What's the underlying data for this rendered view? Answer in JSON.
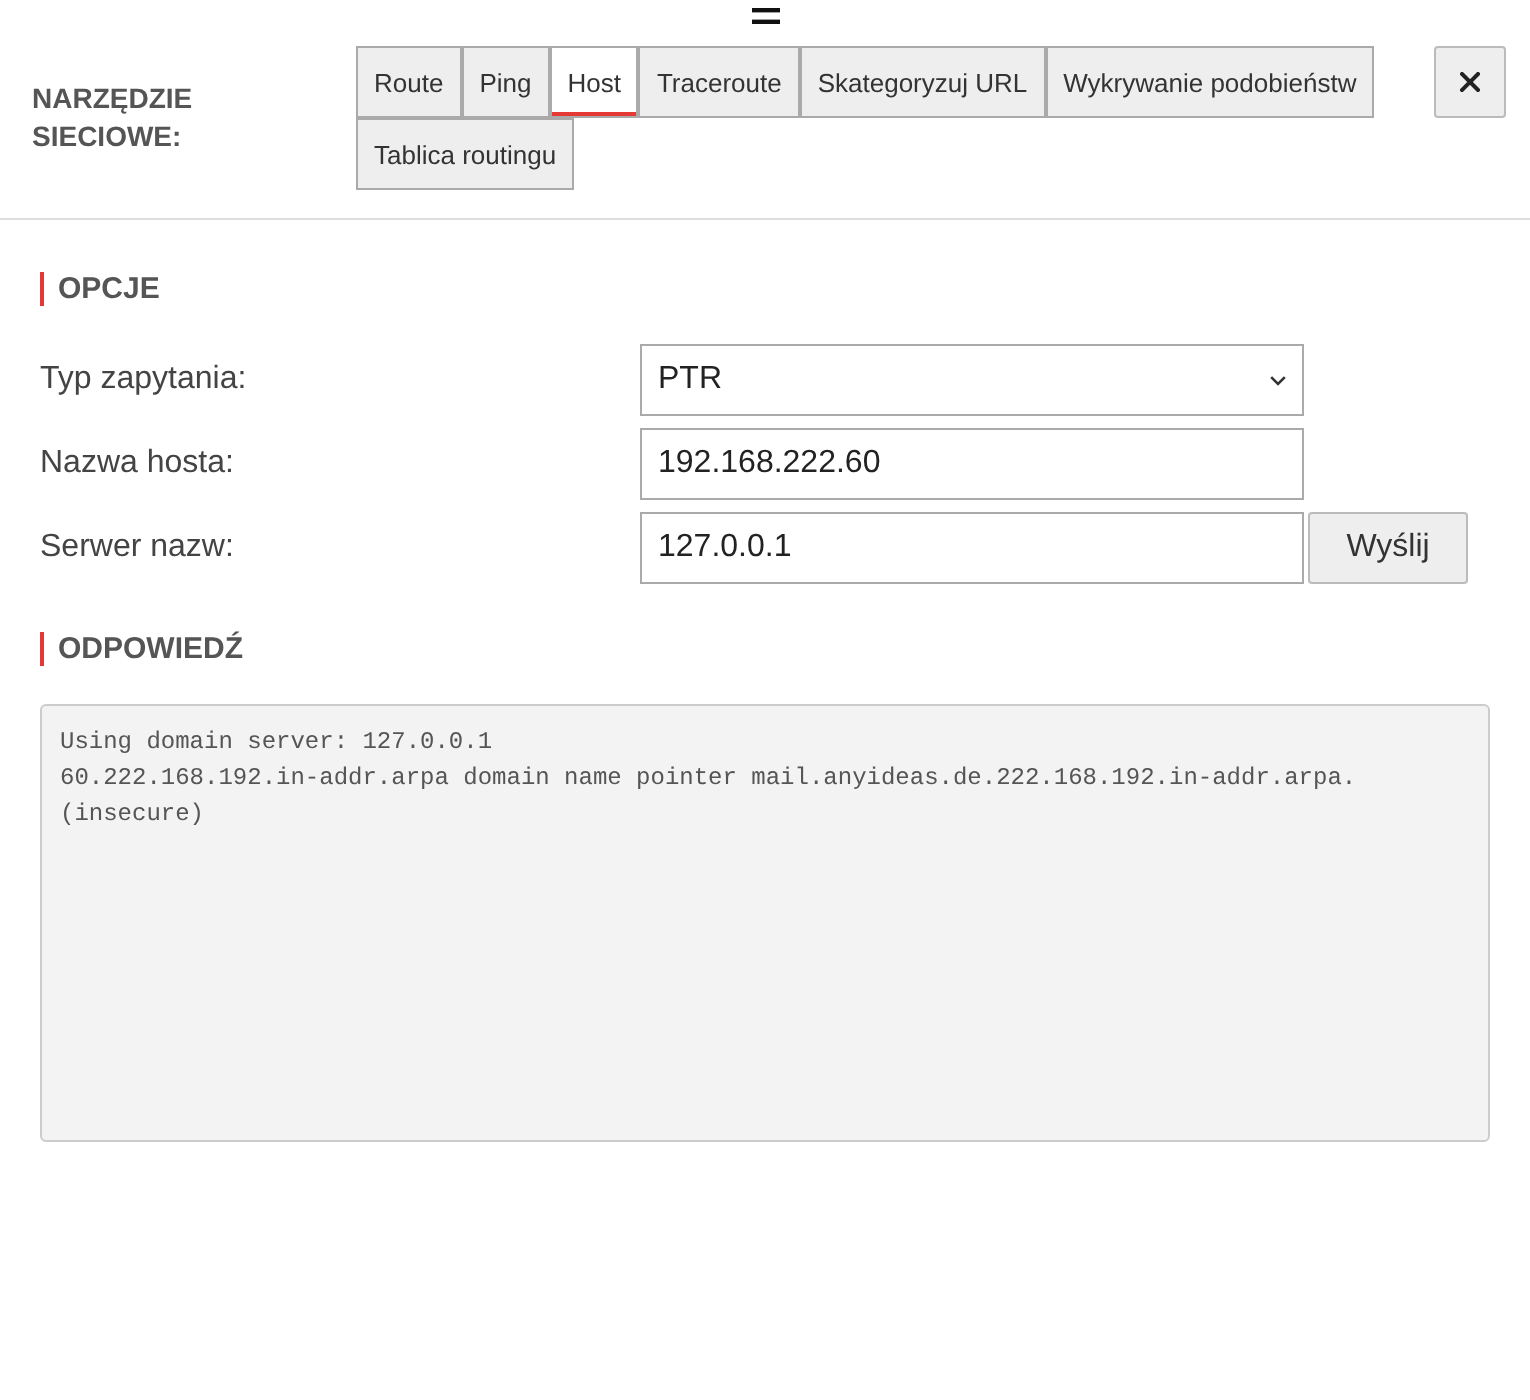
{
  "header": {
    "title": "NARZĘDZIE SIECIOWE:"
  },
  "tabs": [
    {
      "label": "Route",
      "selected": false
    },
    {
      "label": "Ping",
      "selected": false
    },
    {
      "label": "Host",
      "selected": true
    },
    {
      "label": "Traceroute",
      "selected": false
    },
    {
      "label": "Skategoryzuj URL",
      "selected": false
    },
    {
      "label": "Wykrywanie podobieństw",
      "selected": false
    },
    {
      "label": "Tablica routingu",
      "selected": false
    }
  ],
  "options": {
    "heading": "OPCJE",
    "fields": [
      {
        "kind": "select",
        "label": "Typ zapytania:",
        "value": "PTR"
      },
      {
        "kind": "text",
        "label": "Nazwa hosta:",
        "value": "192.168.222.60"
      },
      {
        "kind": "text",
        "label": "Serwer nazw:",
        "value": "127.0.0.1",
        "button": "Wyślij"
      }
    ]
  },
  "response": {
    "heading": "ODPOWIEDŹ",
    "output": "Using domain server: 127.0.0.1\n60.222.168.192.in-addr.arpa domain name pointer mail.anyideas.de.222.168.192.in-addr.arpa. (insecure)"
  }
}
